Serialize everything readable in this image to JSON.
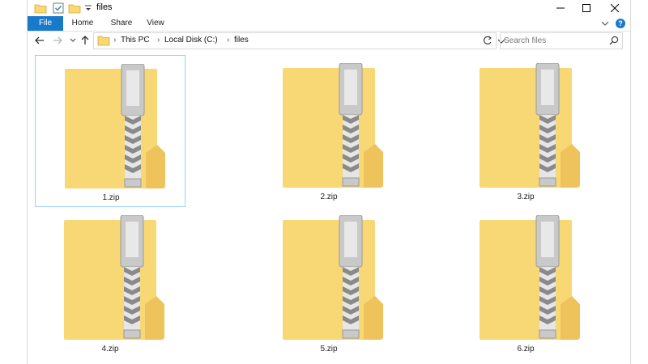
{
  "window": {
    "title": "files"
  },
  "ribbon": {
    "tabs": [
      "File",
      "Home",
      "Share",
      "View"
    ]
  },
  "address": {
    "crumbs": [
      "This PC",
      "Local Disk (C:)",
      "files"
    ]
  },
  "search": {
    "placeholder": "Search files"
  },
  "files": [
    {
      "name": "1.zip",
      "selected": true
    },
    {
      "name": "2.zip",
      "selected": false
    },
    {
      "name": "3.zip",
      "selected": false
    },
    {
      "name": "4.zip",
      "selected": false
    },
    {
      "name": "5.zip",
      "selected": false
    },
    {
      "name": "6.zip",
      "selected": false
    }
  ],
  "colors": {
    "accent": "#1979ca",
    "folder": "#f8d775",
    "folder_dark": "#e8b94a",
    "selection_border": "#99d1ff"
  },
  "icons": {
    "file_icon": "zip-folder-icon",
    "nav_back": "arrow-left-icon",
    "nav_forward": "arrow-right-icon",
    "nav_up": "arrow-up-icon",
    "refresh": "refresh-icon",
    "search": "search-icon"
  }
}
